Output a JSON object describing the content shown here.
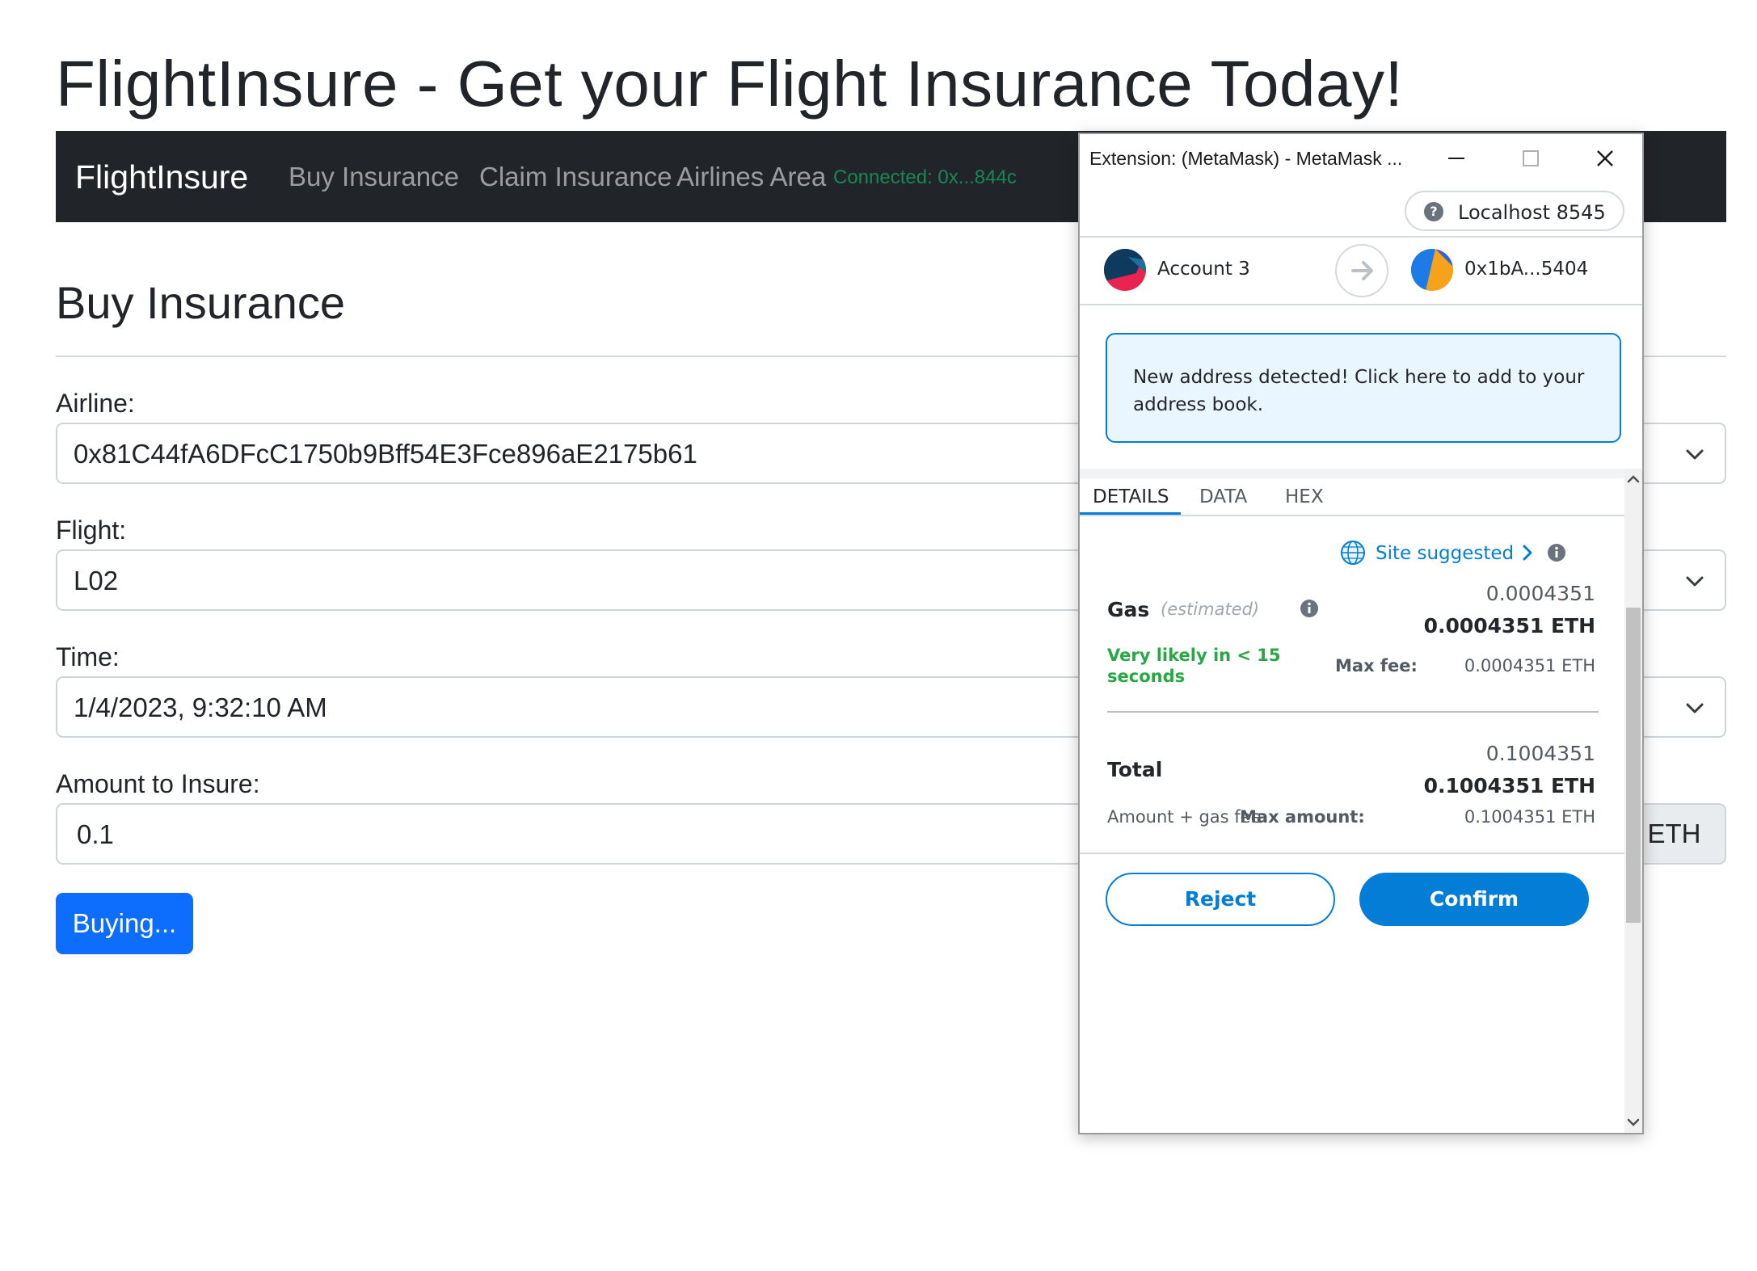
{
  "page": {
    "title": "FlightInsure - Get your Flight Insurance Today!"
  },
  "navbar": {
    "brand": "FlightInsure",
    "links": [
      "Buy Insurance",
      "Claim Insurance",
      "Airlines Area"
    ],
    "connected": "Connected: 0x...844c"
  },
  "form": {
    "section_title": "Buy Insurance",
    "airline_label": "Airline:",
    "airline_value": "0x81C44fA6DFcC1750b9Bff54E3Fce896aE2175b61",
    "flight_label": "Flight:",
    "flight_value": "L02",
    "time_label": "Time:",
    "time_value": "1/4/2023, 9:32:10 AM",
    "amount_label": "Amount to Insure:",
    "amount_value": "0.1",
    "amount_unit": "ETH",
    "submit_label": "Buying..."
  },
  "metamask": {
    "window_title": "Extension: (MetaMask) - MetaMask ...",
    "network": "Localhost 8545",
    "from_account": "Account 3",
    "to_account": "0x1bA...5404",
    "notice": "New address detected! Click here to add to your address book.",
    "tabs": [
      "DETAILS",
      "DATA",
      "HEX"
    ],
    "active_tab": "DETAILS",
    "site_suggested": "Site suggested",
    "gas_label": "Gas",
    "gas_estimated": "(estimated)",
    "gas_value": "0.0004351",
    "gas_value_eth": "0.0004351 ETH",
    "likely": "Very likely in < 15 seconds",
    "max_fee_label": "Max fee:",
    "max_fee_value": "0.0004351 ETH",
    "total_label": "Total",
    "total_value": "0.1004351",
    "total_value_eth": "0.1004351 ETH",
    "amount_gas_fee": "Amount + gas fee",
    "max_amount_label": "Max amount:",
    "max_amount_value": "0.1004351 ETH",
    "reject": "Reject",
    "confirm": "Confirm"
  },
  "colors": {
    "navbar_bg": "#212529",
    "primary_button": "#0d6efd",
    "connected_text": "#198754",
    "metamask_blue": "#037dd6",
    "success_green": "#28a745"
  }
}
